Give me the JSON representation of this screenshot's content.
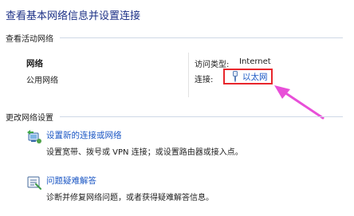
{
  "page_title": "查看基本网络信息并设置连接",
  "active_networks": {
    "header": "查看活动网络",
    "network_name": "网络",
    "network_category": "公用网络",
    "access_type_label": "访问类型:",
    "access_type_value": "Internet",
    "connection_label": "连接:",
    "connection_value": "以太网"
  },
  "change_settings": {
    "header": "更改网络设置",
    "tasks": [
      {
        "title": "设置新的连接或网络",
        "description": "设置宽带、拨号或 VPN 连接；或设置路由器或接入点。",
        "icon": "network-setup-icon"
      },
      {
        "title": "问题疑难解答",
        "description": "诊断并修复网络问题，或者获得疑难解答信息。",
        "icon": "troubleshoot-icon"
      }
    ]
  },
  "colors": {
    "title": "#1e3287",
    "link": "#1a56c4",
    "highlight_box": "#e8262c",
    "arrow": "#e84fd8"
  }
}
